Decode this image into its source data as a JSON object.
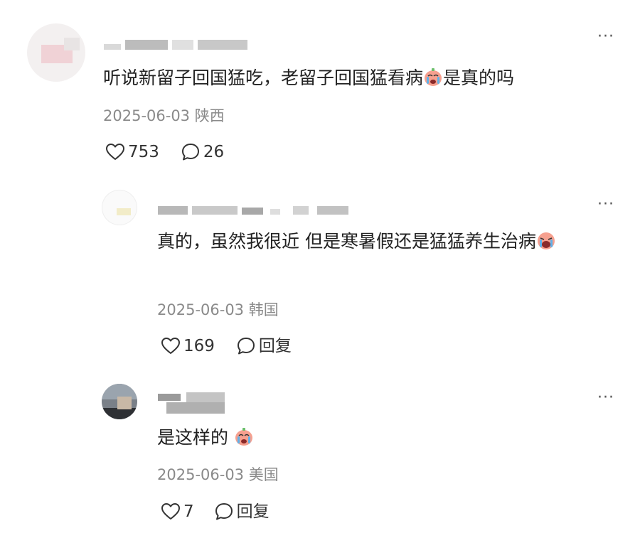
{
  "comments": [
    {
      "text_a": "听说新留子回国猛吃，老留子回国猛看病",
      "text_b": "是真的吗",
      "date": "2025-06-03",
      "location": "陕西",
      "likes": "753",
      "replies": "26",
      "emoji_icon": "crying-face-emoji"
    },
    {
      "text_a": "真的，虽然我很近 但是寒暑假还是猛猛养生治病",
      "date": "2025-06-03",
      "location": "韩国",
      "likes": "169",
      "reply_label": "回复",
      "emoji_icon": "crying-face-emoji"
    },
    {
      "text_a": "是这样的 ",
      "date": "2025-06-03",
      "location": "美国",
      "likes": "7",
      "reply_label": "回复",
      "emoji_icon": "crying-face-emoji"
    }
  ],
  "more_label": "···",
  "icons": {
    "like": "heart-outline-icon",
    "comment": "speech-bubble-icon",
    "more": "more-dots-icon"
  },
  "colors": {
    "text": "#222222",
    "meta": "#8a8a8a",
    "emoji_face": "#f6a08f",
    "emoji_tear": "#5fb2ea"
  }
}
